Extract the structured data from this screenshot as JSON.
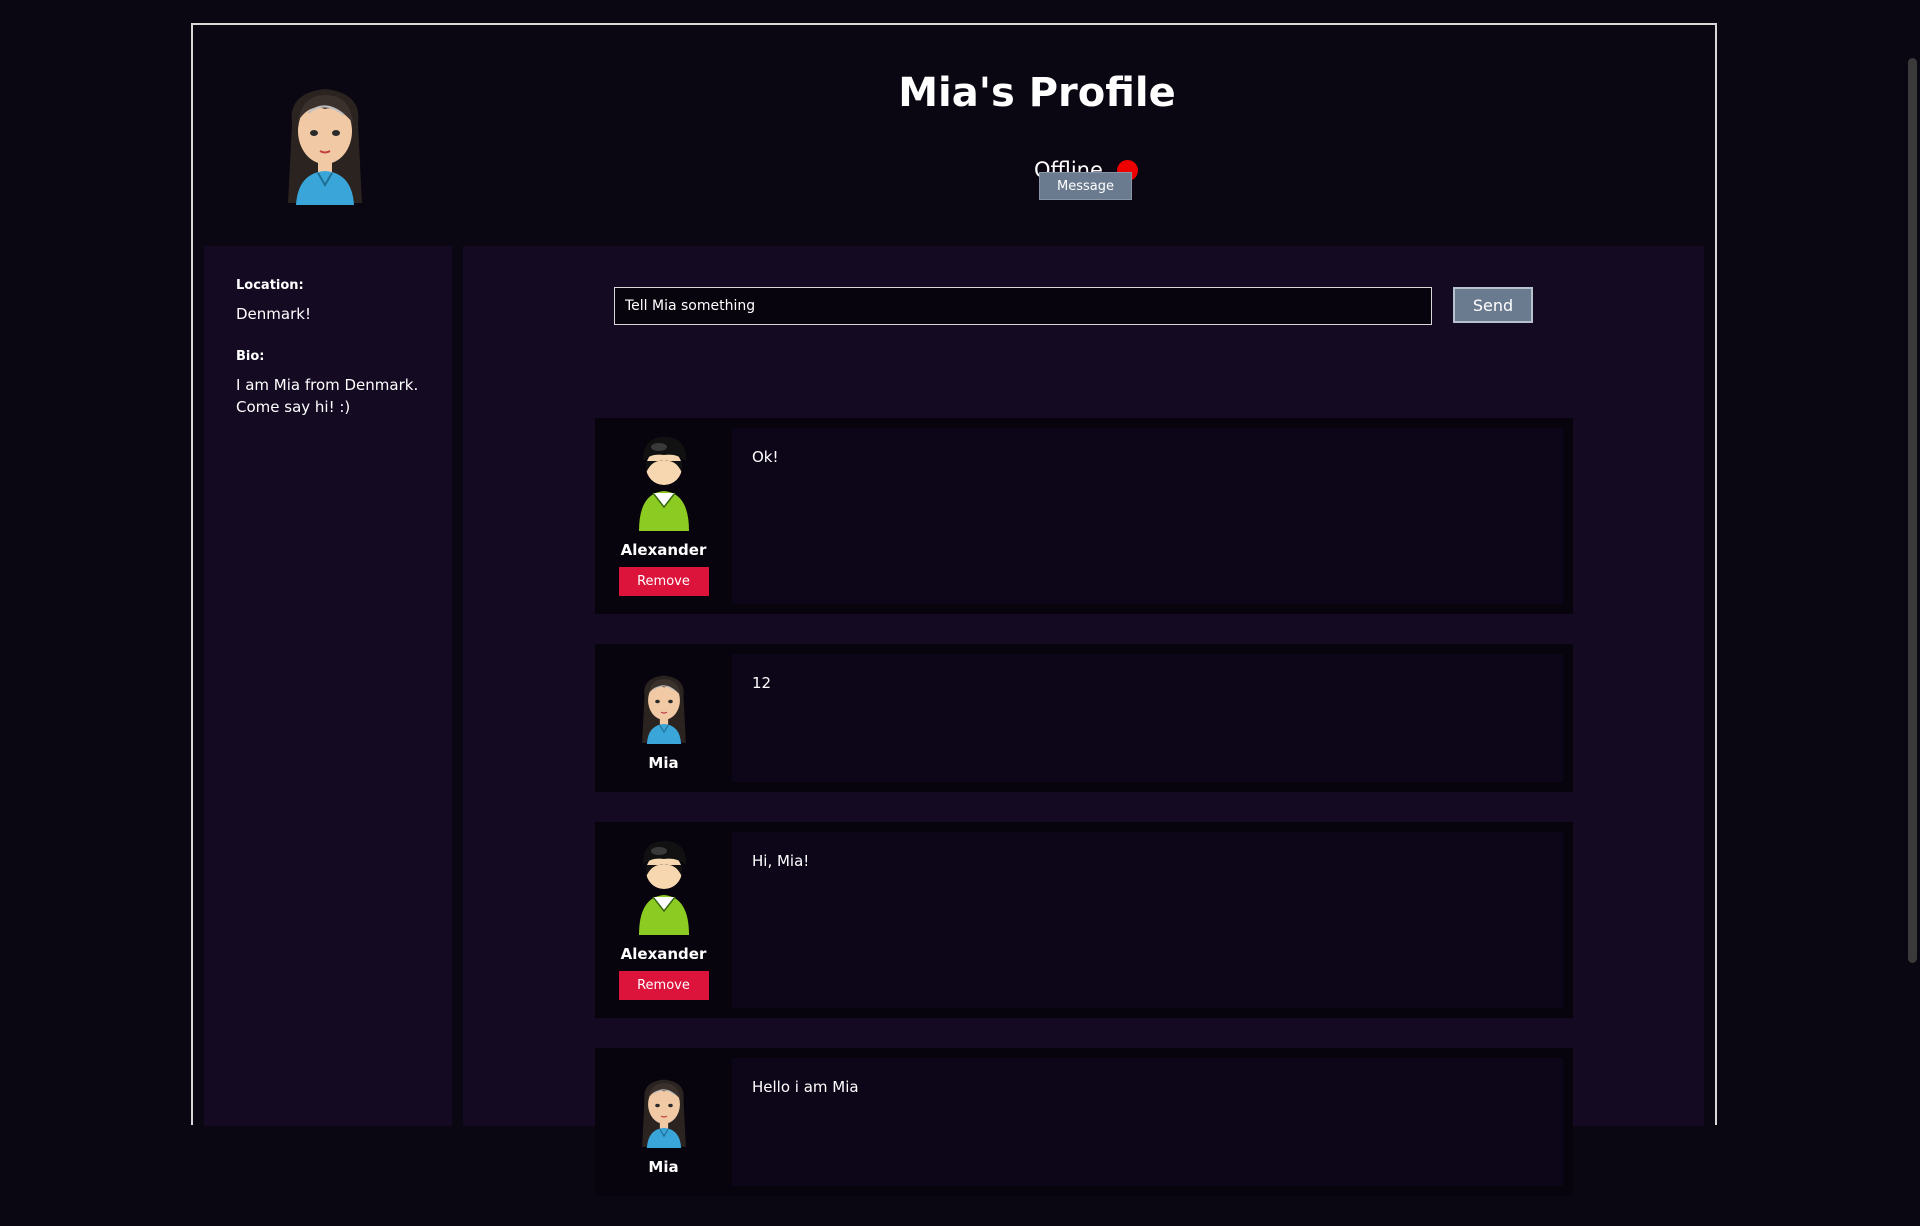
{
  "profile": {
    "title": "Mia's Profile",
    "status": "Offline",
    "status_color": "#ee0000",
    "message_label": "Message"
  },
  "sidebar": {
    "location_label": "Location:",
    "location_value": "Denmark!",
    "bio_label": "Bio:",
    "bio_value": "I am Mia from Denmark. Come say hi! :)"
  },
  "composer": {
    "placeholder": "Tell Mia something",
    "send_label": "Send"
  },
  "posts": [
    {
      "author": "Alexander",
      "avatar": "male-avatar-icon",
      "text": "Ok!",
      "remove_label": "Remove"
    },
    {
      "author": "Mia",
      "avatar": "female-avatar-icon",
      "text": "12"
    },
    {
      "author": "Alexander",
      "avatar": "male-avatar-icon",
      "text": "Hi, Mia!",
      "remove_label": "Remove"
    },
    {
      "author": "Mia",
      "avatar": "female-avatar-icon",
      "text": "Hello i am Mia"
    }
  ],
  "colors": {
    "background": "#0a0612",
    "panel": "#140a22",
    "button": "#6b7b8f",
    "remove": "#dc143c"
  }
}
